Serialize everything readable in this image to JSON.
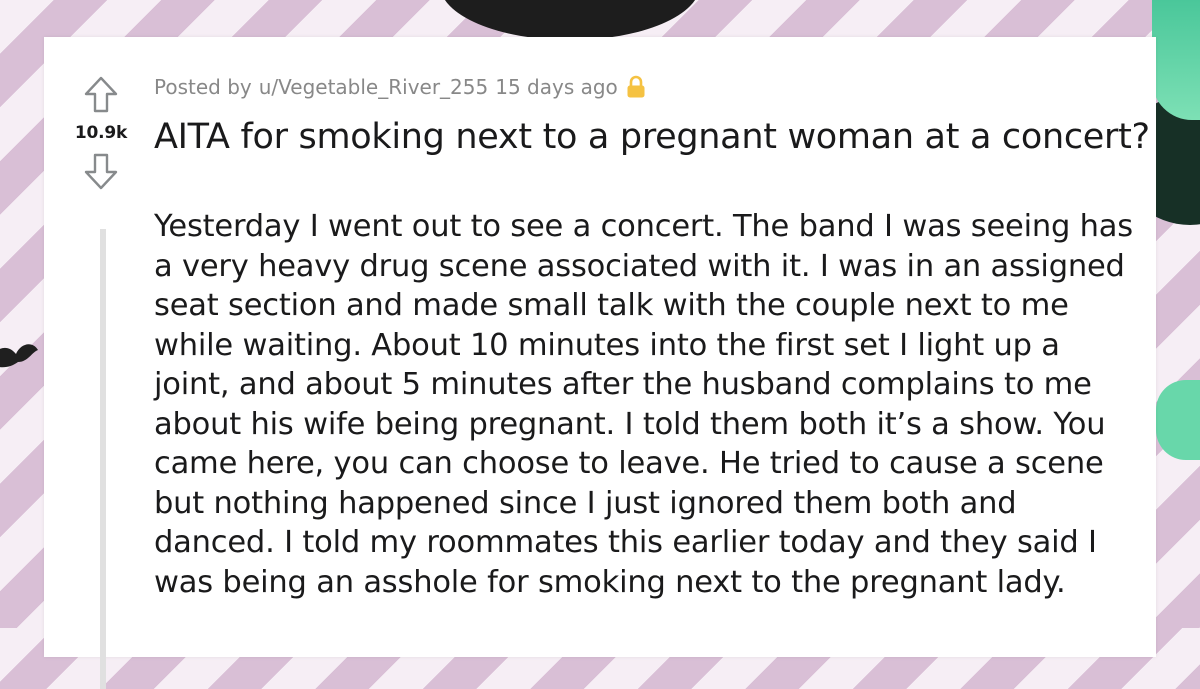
{
  "post": {
    "posted_by_prefix": "Posted by",
    "username": "u/Vegetable_River_255",
    "time_ago": "15 days ago",
    "vote_count": "10.9k",
    "title": "AITA for smoking next to a pregnant woman at a concert?",
    "body": "Yesterday I went out to see a concert. The band I was seeing has a very heavy drug scene associated with it. I was in an assigned seat section and made small talk with the couple next to me while waiting. About 10 minutes into the first set I light up a joint, and about 5 minutes after the husband complains to me about his wife being pregnant. I told them both it’s a show. You came here, you can choose to leave. He tried to cause a scene but nothing happened since I just ignored them both and danced. I told my roommates this earlier today and they said I was being an asshole for smoking next to the pregnant lady."
  },
  "icons": {
    "upvote": "arrow-up-icon",
    "downvote": "arrow-down-icon",
    "lock": "lock-icon"
  },
  "colors": {
    "lock": "#f5c242",
    "meta_text": "#888888",
    "body_text": "#1a1a1b"
  }
}
